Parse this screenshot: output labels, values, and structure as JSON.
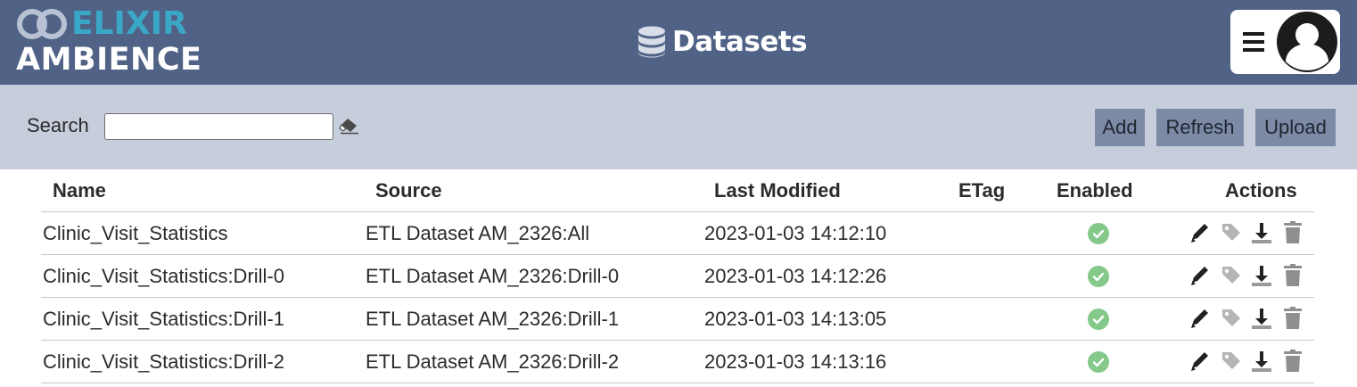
{
  "brand": {
    "line1": "ELIXIR",
    "line2": "AMBIENCE"
  },
  "header": {
    "title": "Datasets",
    "icon": "database-icon",
    "menu_icon": "hamburger-menu-icon",
    "avatar_icon": "user-avatar-icon"
  },
  "toolbar": {
    "search_label": "Search",
    "search_value": "",
    "search_placeholder": "",
    "clear_icon": "eraser-icon",
    "add_label": "Add",
    "refresh_label": "Refresh",
    "upload_label": "Upload"
  },
  "table": {
    "columns": {
      "name": "Name",
      "source": "Source",
      "last_modified": "Last Modified",
      "etag": "ETag",
      "enabled": "Enabled",
      "actions": "Actions"
    },
    "rows": [
      {
        "name": "Clinic_Visit_Statistics",
        "source": "ETL Dataset AM_2326:All",
        "last_modified": "2023-01-03 14:12:10",
        "etag": "",
        "enabled": true
      },
      {
        "name": "Clinic_Visit_Statistics:Drill-0",
        "source": "ETL Dataset AM_2326:Drill-0",
        "last_modified": "2023-01-03 14:12:26",
        "etag": "",
        "enabled": true
      },
      {
        "name": "Clinic_Visit_Statistics:Drill-1",
        "source": "ETL Dataset AM_2326:Drill-1",
        "last_modified": "2023-01-03 14:13:05",
        "etag": "",
        "enabled": true
      },
      {
        "name": "Clinic_Visit_Statistics:Drill-2",
        "source": "ETL Dataset AM_2326:Drill-2",
        "last_modified": "2023-01-03 14:13:16",
        "etag": "",
        "enabled": true
      }
    ],
    "row_actions": [
      "pencil-edit-icon",
      "tag-icon",
      "download-icon",
      "trash-icon"
    ]
  },
  "colors": {
    "header_bg": "#506286",
    "toolbar_bg": "#c6cddb",
    "button_bg": "#7d8aa6",
    "logo_accent": "#3aa7c7",
    "enabled_green": "#84c98a"
  }
}
